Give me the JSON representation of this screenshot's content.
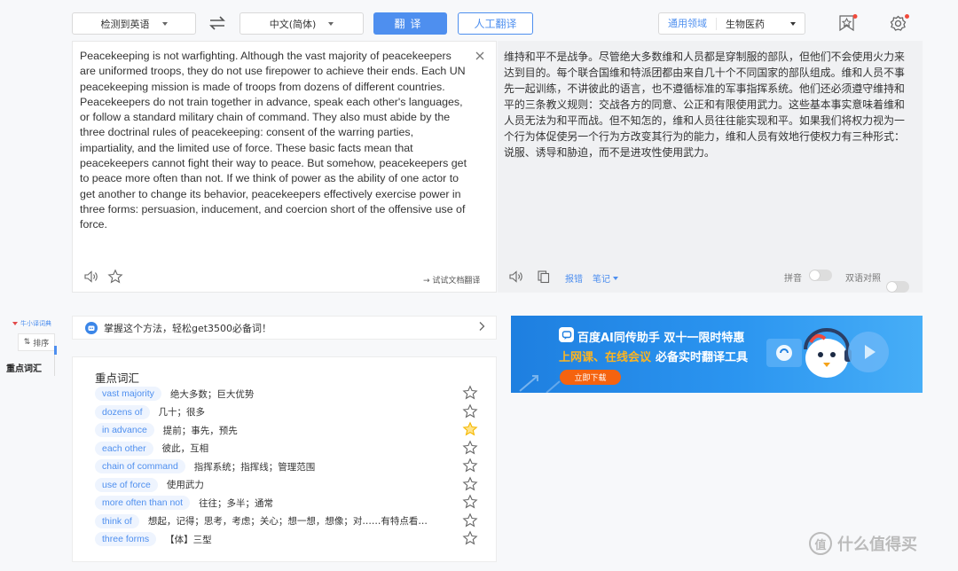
{
  "toolbar": {
    "source_lang": "检测到英语",
    "target_lang": "中文(简体)",
    "translate_label": "翻译",
    "human_translate_label": "人工翻译",
    "domain_label": "通用领域",
    "domain_value": "生物医药"
  },
  "source": {
    "text": "Peacekeeping is not warfighting. Although the vast majority of peacekeepers are uniformed troops, they do not use firepower to achieve their ends. Each UN peacekeeping mission is made of troops from dozens of different countries. Peacekeepers do not train together in advance, speak each other's languages, or follow a standard military chain of command. They also must abide by the three doctrinal rules of peacekeeping: consent of the warring parties, impartiality, and the limited use of force. These basic facts mean that peacekeepers cannot fight their way to peace. But somehow, peacekeepers get to peace more often than not. If we think of power as the ability of one actor to get another to change its behavior, peacekeepers effectively exercise power in three forms: persuasion, inducement, and coercion short of the offensive use of force.",
    "doc_translate_label": "→ 试试文档翻译"
  },
  "target": {
    "text": "维持和平不是战争。尽管绝大多数维和人员都是穿制服的部队，但他们不会使用火力来达到目的。每个联合国维和特派团都由来自几十个不同国家的部队组成。维和人员不事先一起训练，不讲彼此的语言，也不遵循标准的军事指挥系统。他们还必须遵守维持和平的三条教义规则：交战各方的同意、公正和有限使用武力。这些基本事实意味着维和人员无法为和平而战。但不知怎的，维和人员往往能实现和平。如果我们将权力视为一个行为体促使另一个行为方改变其行为的能力，维和人员有效地行使权力有三种形式：说服、诱导和胁迫，而不是进攻性使用武力。",
    "report_label": "报错",
    "notes_label": "笔记",
    "pinyin_label": "拼音",
    "bilingual_label": "双语对照"
  },
  "side": {
    "mini_dict": "牛小译词典",
    "sort_label": "排序",
    "key_vocab": "重点词汇"
  },
  "tip": {
    "text": "掌握这个方法，轻松get3500必备词！"
  },
  "vocab": {
    "title": "重点词汇",
    "items": [
      {
        "term": "vast majority",
        "meaning": "绝大多数；巨大优势",
        "starred": false
      },
      {
        "term": "dozens of",
        "meaning": "几十；很多",
        "starred": false
      },
      {
        "term": "in advance",
        "meaning": "提前；事先，预先",
        "starred": true
      },
      {
        "term": "each other",
        "meaning": "彼此，互相",
        "starred": false
      },
      {
        "term": "chain of command",
        "meaning": "指挥系统；指挥线；管理范围",
        "starred": false
      },
      {
        "term": "use of force",
        "meaning": "使用武力",
        "starred": false
      },
      {
        "term": "more often than not",
        "meaning": "往往；多半；通常",
        "starred": false
      },
      {
        "term": "think of",
        "meaning": "想起，记得；思考，考虑；关心；想一想，想像；对……有特点看法；…",
        "starred": false
      },
      {
        "term": "three forms",
        "meaning": "【体】三型",
        "starred": false
      }
    ]
  },
  "banner": {
    "title": "百度AI同传助手 双十一限时特惠",
    "subtitle_highlight": "上网课、在线会议",
    "subtitle_rest": "必备实时翻译工具",
    "cta": "立即下载"
  },
  "watermark": {
    "text": "值 什么值得买"
  },
  "colors": {
    "accent": "#4e8fef",
    "star_active": "#f5b800",
    "banner_cta": "#f5630f"
  }
}
